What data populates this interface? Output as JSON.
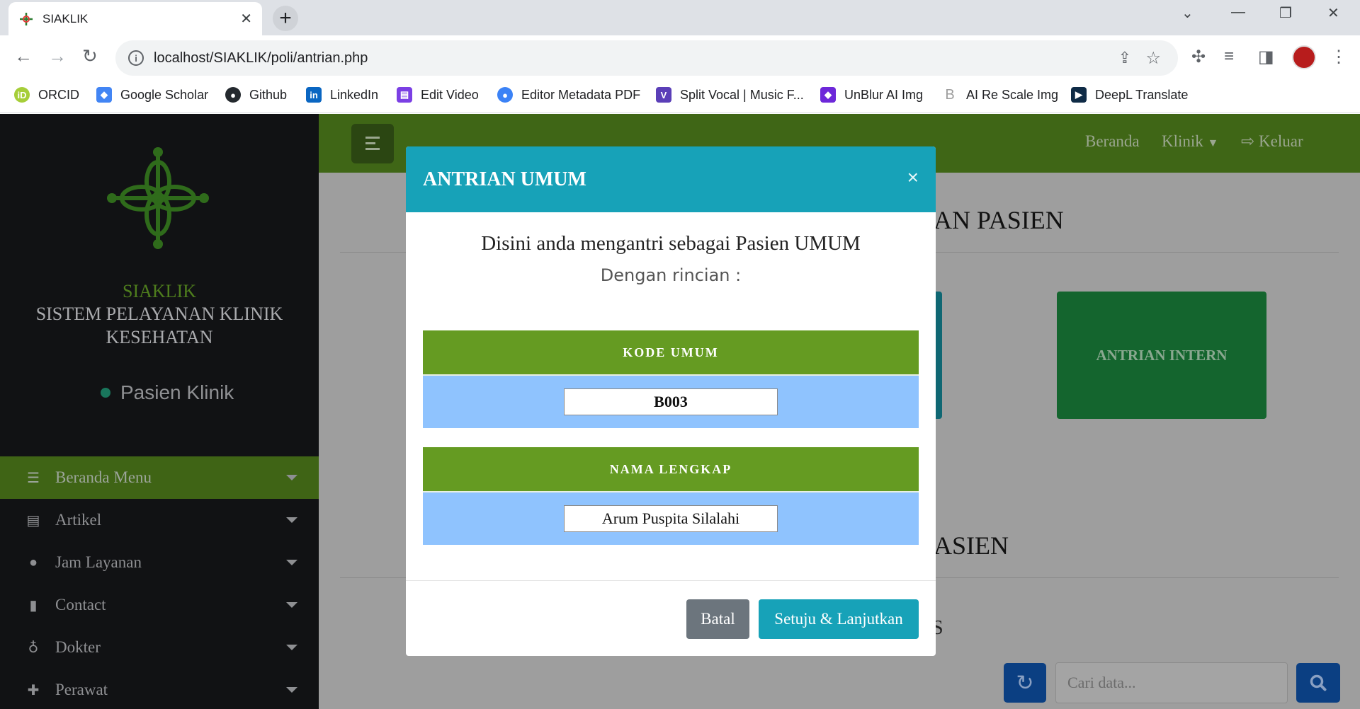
{
  "browser": {
    "tab_title": "SIAKLIK",
    "url": "localhost/SIAKLIK/poli/antrian.php",
    "bookmarks": [
      {
        "label": "ORCID",
        "color": "#a6ce39",
        "glyph": "iD"
      },
      {
        "label": "Google Scholar",
        "color": "#4285f4",
        "glyph": "◆"
      },
      {
        "label": "Github",
        "color": "#24292e",
        "glyph": "●"
      },
      {
        "label": "LinkedIn",
        "color": "#0a66c2",
        "glyph": "in"
      },
      {
        "label": "Edit Video",
        "color": "#7b3fe4",
        "glyph": "▤"
      },
      {
        "label": "Editor Metadata PDF",
        "color": "#3b82f6",
        "glyph": "●"
      },
      {
        "label": "Split Vocal | Music F...",
        "color": "#5b3fb8",
        "glyph": "V"
      },
      {
        "label": "UnBlur AI Img",
        "color": "#6d28d9",
        "glyph": "◆"
      },
      {
        "label": "AI Re Scale Img",
        "color": "#9e9e9e",
        "glyph": "B"
      },
      {
        "label": "DeepL Translate",
        "color": "#0f2b46",
        "glyph": "▶"
      }
    ]
  },
  "sidebar": {
    "brand_line1": "SIAKLIK",
    "brand_line2": "SISTEM PELAYANAN KLINIK",
    "brand_line3": "KESEHATAN",
    "user_label": "Pasien Klinik",
    "menu": [
      {
        "label": "Beranda Menu",
        "icon": "list-icon",
        "glyph": "☰"
      },
      {
        "label": "Artikel",
        "icon": "newspaper-icon",
        "glyph": "▤"
      },
      {
        "label": "Jam Layanan",
        "icon": "clock-icon",
        "glyph": "●"
      },
      {
        "label": "Contact",
        "icon": "contact-book-icon",
        "glyph": "▮"
      },
      {
        "label": "Dokter",
        "icon": "stethoscope-icon",
        "glyph": "♁"
      },
      {
        "label": "Perawat",
        "icon": "medkit-icon",
        "glyph": "✚"
      }
    ]
  },
  "topnav": {
    "home": "Beranda",
    "klinik": "Klinik",
    "logout": "Keluar"
  },
  "content": {
    "heading1_fragment": "AN PASIEN",
    "intern_button": "ANTRIAN INTERN",
    "heading2_fragment": "ASIEN",
    "fragment3": "S",
    "search_placeholder": "Cari data..."
  },
  "modal": {
    "title": "ANTRIAN UMUM",
    "close": "×",
    "intro": "Disini anda mengantri sebagai Pasien UMUM",
    "sub": "Dengan rincian :",
    "code_label": "KODE UMUM",
    "code_value": "B003",
    "name_label": "NAMA LENGKAP",
    "name_value": "Arum Puspita Silalahi",
    "cancel": "Batal",
    "confirm": "Setuju & Lanjutkan"
  },
  "colors": {
    "modal_header": "#17a2b8",
    "field_label": "#659b22",
    "field_value_bg": "#8fc3fe",
    "cancel_button": "#6c757d"
  }
}
